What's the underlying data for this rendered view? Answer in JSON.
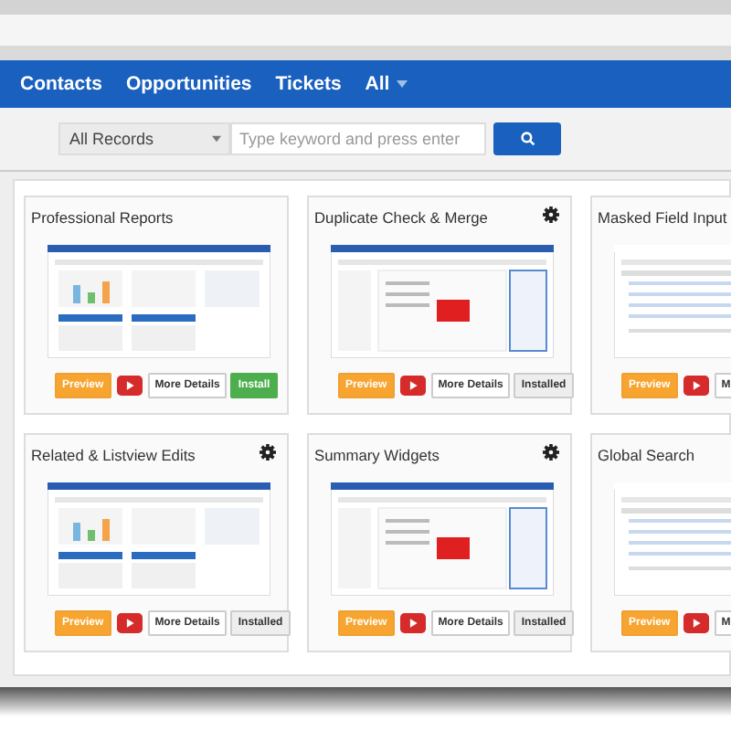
{
  "nav": {
    "items": [
      {
        "label": "Contacts",
        "dropdown": false
      },
      {
        "label": "Opportunities",
        "dropdown": false
      },
      {
        "label": "Tickets",
        "dropdown": false
      },
      {
        "label": "All",
        "dropdown": true
      }
    ]
  },
  "search": {
    "scope": "All Records",
    "placeholder": "Type keyword and press enter"
  },
  "cards": [
    {
      "title": "Professional Reports",
      "settings": false,
      "buttons": [
        {
          "kind": "preview",
          "label": "Preview"
        },
        {
          "kind": "video"
        },
        {
          "kind": "details",
          "label": "More Details"
        },
        {
          "kind": "install",
          "label": "Install"
        }
      ]
    },
    {
      "title": "Duplicate Check & Merge",
      "settings": true,
      "buttons": [
        {
          "kind": "preview",
          "label": "Preview"
        },
        {
          "kind": "video"
        },
        {
          "kind": "details",
          "label": "More Details"
        },
        {
          "kind": "installed",
          "label": "Installed"
        }
      ]
    },
    {
      "title": "Masked Field Input",
      "settings": false,
      "buttons": [
        {
          "kind": "preview",
          "label": "Preview"
        },
        {
          "kind": "video"
        },
        {
          "kind": "details",
          "label": "M"
        }
      ]
    },
    {
      "title": "Related & Listview Edits",
      "settings": true,
      "buttons": [
        {
          "kind": "preview",
          "label": "Preview"
        },
        {
          "kind": "video"
        },
        {
          "kind": "details",
          "label": "More Details"
        },
        {
          "kind": "installed",
          "label": "Installed"
        }
      ]
    },
    {
      "title": "Summary Widgets",
      "settings": true,
      "buttons": [
        {
          "kind": "preview",
          "label": "Preview"
        },
        {
          "kind": "video"
        },
        {
          "kind": "details",
          "label": "More Details"
        },
        {
          "kind": "installed",
          "label": "Installed"
        }
      ]
    },
    {
      "title": "Global Search",
      "settings": false,
      "buttons": [
        {
          "kind": "preview",
          "label": "Preview"
        },
        {
          "kind": "video"
        },
        {
          "kind": "details",
          "label": "M"
        }
      ]
    }
  ]
}
